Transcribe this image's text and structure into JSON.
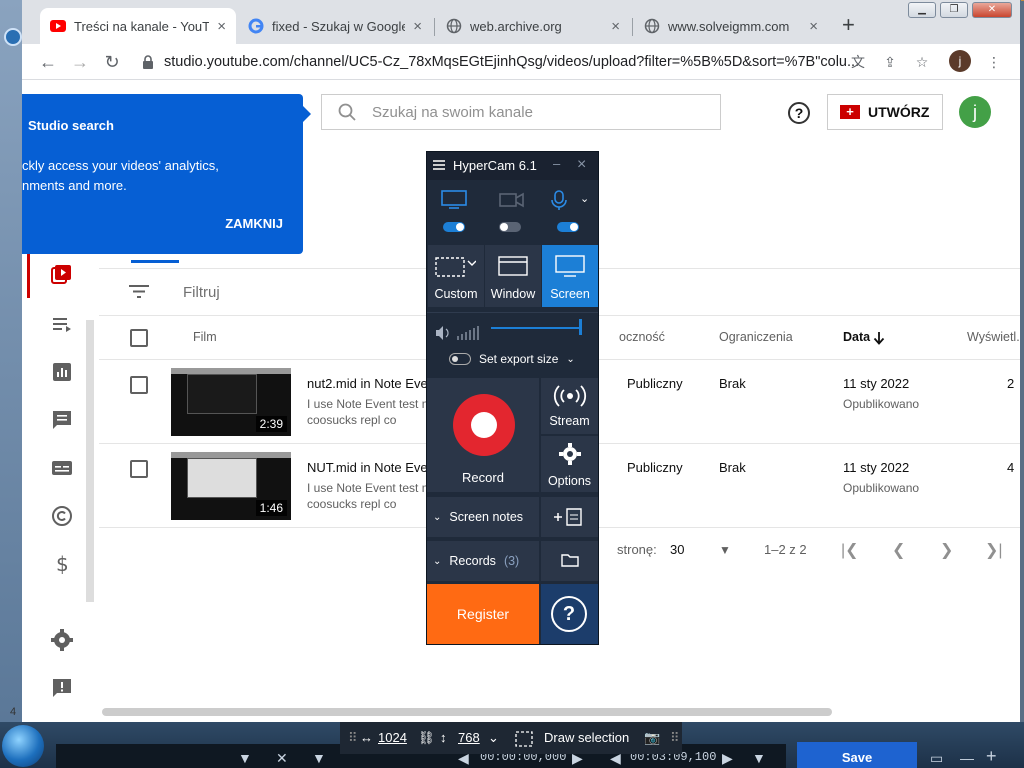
{
  "browser": {
    "tabs": [
      {
        "title": "Treści na kanale - YouTub",
        "icon": "youtube-icon"
      },
      {
        "title": "fixed - Szukaj w Google",
        "icon": "google-icon"
      },
      {
        "title": "web.archive.org",
        "icon": "globe-icon"
      },
      {
        "title": "www.solveigmm.com",
        "icon": "globe-icon"
      }
    ],
    "url": "studio.youtube.com/channel/UC5-Cz_78xMqsEGtEjinhQsg/videos/upload?filter=%5B%5D&sort=%7B\"colu...",
    "profile_initial": "j"
  },
  "studio": {
    "search_placeholder": "Szukaj na swoim kanale",
    "create_label": "UTWÓRZ",
    "avatar_initial": "j",
    "tooltip": {
      "title": "Studio search",
      "body": "ckly access your videos' analytics,\nnments and more.",
      "close": "ZAMKNIJ"
    },
    "filter_label": "Filtruj",
    "columns": {
      "film": "Film",
      "visibility": "oczność",
      "restrictions": "Ograniczenia",
      "date": "Data",
      "views": "Wyświetl..."
    },
    "videos": [
      {
        "title": "nut2.mid in Note Event",
        "desc": "I use Note Event test m\ncoosucks repl co",
        "duration": "2:39",
        "visibility": "Publiczny",
        "restrictions": "Brak",
        "date": "11 sty 2022",
        "status": "Opublikowano",
        "views": "2"
      },
      {
        "title": "NUT.mid in Note Event",
        "desc": "I use Note Event test m\ncoosucks repl co",
        "duration": "1:46",
        "visibility": "Publiczny",
        "restrictions": "Brak",
        "date": "11 sty 2022",
        "status": "Opublikowano",
        "views": "4"
      }
    ],
    "pager": {
      "rows_label": "stronę:",
      "rows_value": "30",
      "range": "1–2 z 2"
    }
  },
  "hypercam": {
    "title": "HyperCam 6.1",
    "modes": [
      "Custom",
      "Window",
      "Screen"
    ],
    "export_label": "Set export size",
    "record_label": "Record",
    "stream_label": "Stream",
    "options_label": "Options",
    "screen_notes": "Screen notes",
    "records_label": "Records",
    "records_count": "(3)",
    "register_label": "Register",
    "help_label": "?"
  },
  "selection_toolbar": {
    "width": "1024",
    "height": "768",
    "draw_label": "Draw selection"
  },
  "taskbar": {
    "time_start": "00:00:00,000",
    "time_end": "00:03:09,100",
    "save_label": "Save"
  },
  "os": {
    "corner_text": "4"
  },
  "colors": {
    "accent": "#065fd4",
    "record": "#e3262f",
    "register": "#ff6a13",
    "hc_active": "#1c7fd6"
  }
}
